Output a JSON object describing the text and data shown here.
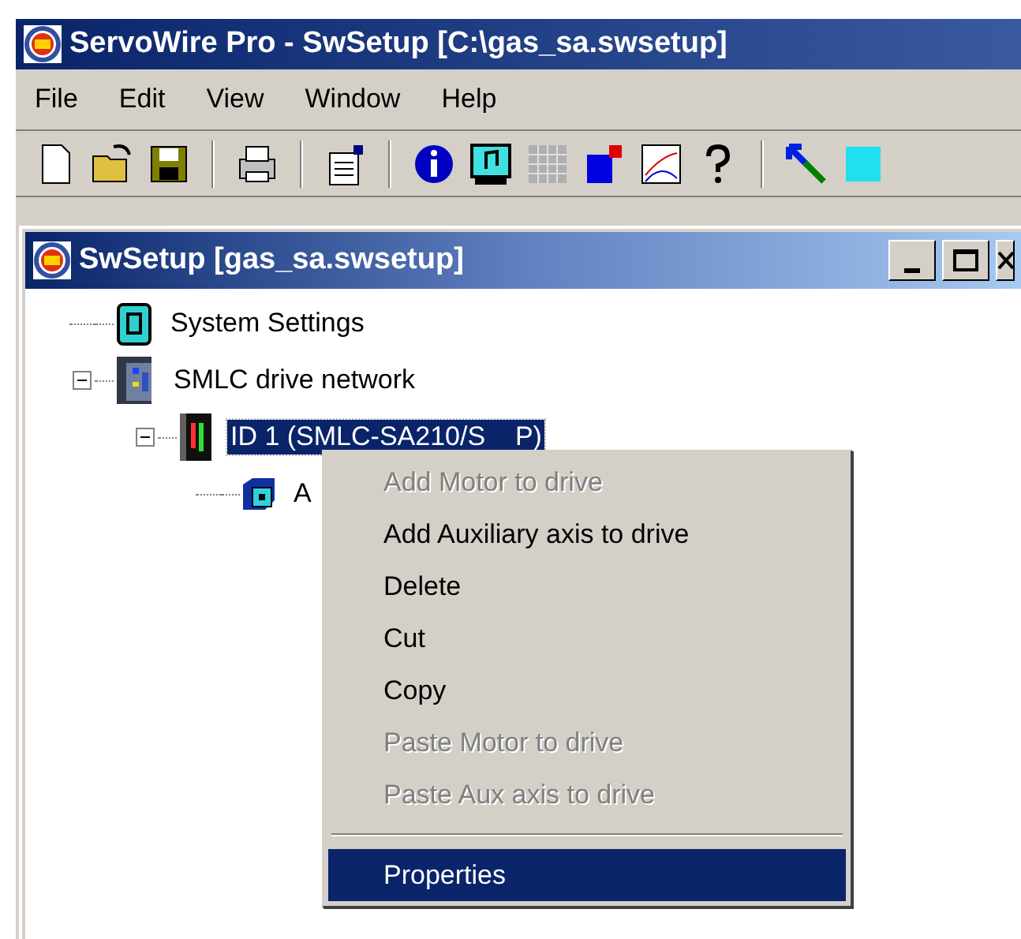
{
  "window": {
    "title": "ServoWire Pro - SwSetup [C:\\gas_sa.swsetup]"
  },
  "menu_bar": [
    "File",
    "Edit",
    "View",
    "Window",
    "Help"
  ],
  "child_window": {
    "title": "SwSetup [gas_sa.swsetup]"
  },
  "tree": [
    {
      "label": "System Settings",
      "kind": "settings",
      "selected": false
    },
    {
      "label": "SMLC drive network",
      "kind": "network",
      "selected": false,
      "expanded": true,
      "children": [
        {
          "label": "ID 1 (SMLC-SA210/S    P)",
          "kind": "drive",
          "selected": true,
          "expanded": true,
          "children": [
            {
              "label": "A",
              "kind": "axis",
              "selected": false
            }
          ]
        }
      ]
    }
  ],
  "context_menu": [
    {
      "kind": "item",
      "label": "Add Motor to drive",
      "disabled": true,
      "selected": false
    },
    {
      "kind": "item",
      "label": "Add Auxiliary axis to drive",
      "disabled": false,
      "selected": false
    },
    {
      "kind": "item",
      "label": "Delete",
      "disabled": false,
      "selected": false
    },
    {
      "kind": "item",
      "label": "Cut",
      "disabled": false,
      "selected": false
    },
    {
      "kind": "item",
      "label": "Copy",
      "disabled": false,
      "selected": false
    },
    {
      "kind": "item",
      "label": "Paste Motor to drive",
      "disabled": true,
      "selected": false
    },
    {
      "kind": "item",
      "label": "Paste Aux axis to drive",
      "disabled": true,
      "selected": false
    },
    {
      "kind": "separator"
    },
    {
      "kind": "item",
      "label": "Properties",
      "disabled": false,
      "selected": true
    }
  ]
}
